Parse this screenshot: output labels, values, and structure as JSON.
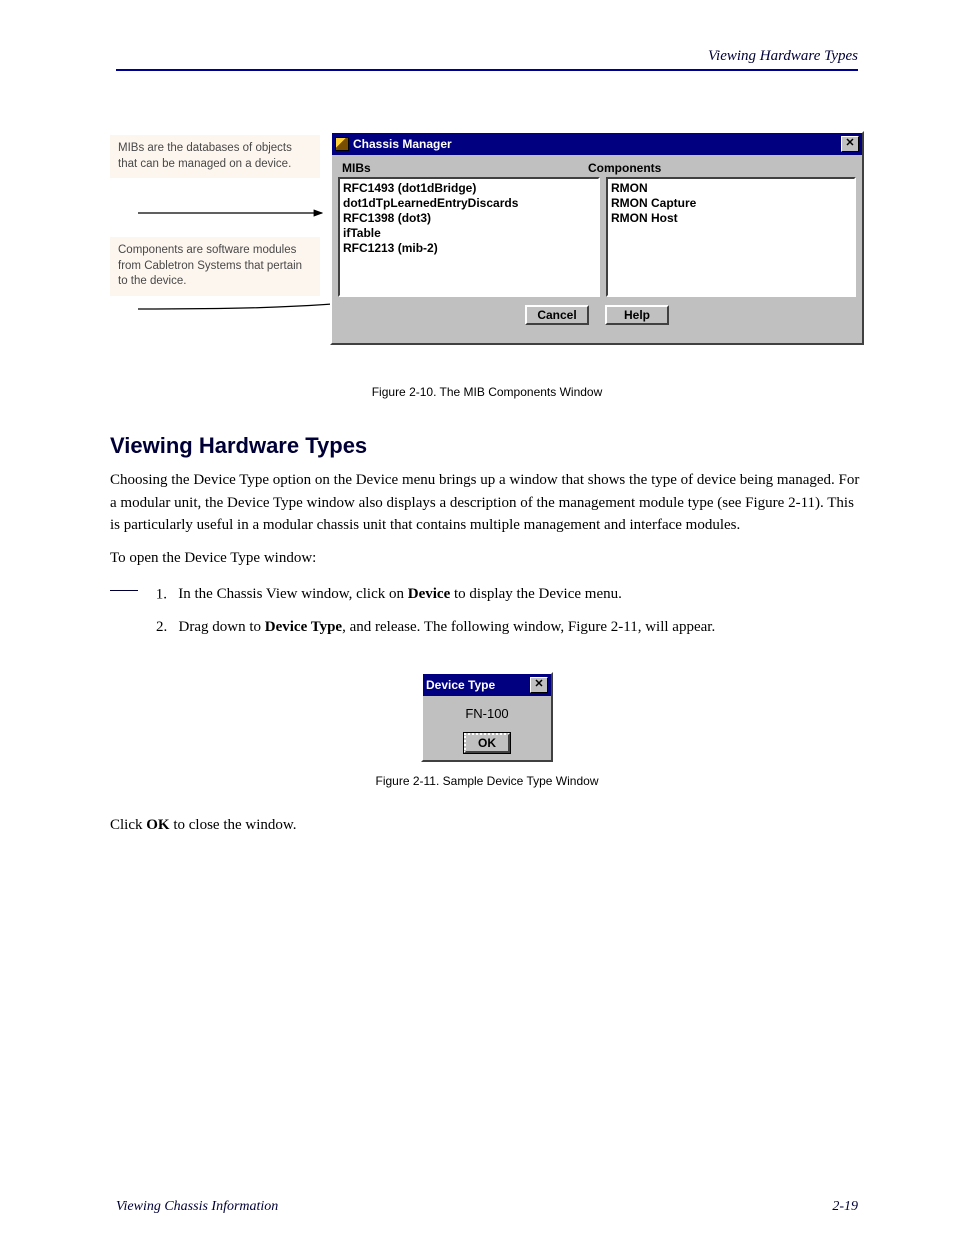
{
  "header": {
    "section_title": "Viewing Hardware Types"
  },
  "fig2_10": {
    "caption1": "MIBs are the databases of objects that can be managed on a device.",
    "caption2": "Components are software modules from Cabletron Systems that pertain to the device.",
    "window_title": "Chassis Manager",
    "label_mibs": "MIBs",
    "label_components": "Components",
    "mibs_items": [
      "RFC1493 (dot1dBridge)",
      "dot1dTpLearnedEntryDiscards",
      "RFC1398 (dot3)",
      "ifTable",
      "RFC1213 (mib-2)"
    ],
    "components_items": [
      "RMON",
      "RMON Capture",
      "RMON Host"
    ],
    "cancel_label": "Cancel",
    "help_label": "Help"
  },
  "figure_label": "Figure 2-10. The MIB Components Window",
  "section": {
    "title": "Viewing Hardware Types"
  },
  "paragraphs": {
    "p1": "Choosing the Device Type option on the Device menu brings up a window that shows the type of device being managed. For a modular unit, the Device Type window also displays a description of the management module type (see Figure 2-11). This is particularly useful in a modular chassis unit that contains multiple management and interface modules.",
    "p2": "To open the Device Type window:",
    "step1": "In the Chassis View window, click on Device to display the Device menu.",
    "step2": "Drag down to Device Type, and release. The following window, Figure 2-11, will appear."
  },
  "device_window": {
    "title": "Device Type",
    "value": "FN-100",
    "ok_label": "OK"
  },
  "figure2_label": "Figure 2-11. Sample Device Type Window",
  "last_para": "Click OK to close the window.",
  "footer": "Viewing Chassis Information",
  "footer_page": "2-19"
}
